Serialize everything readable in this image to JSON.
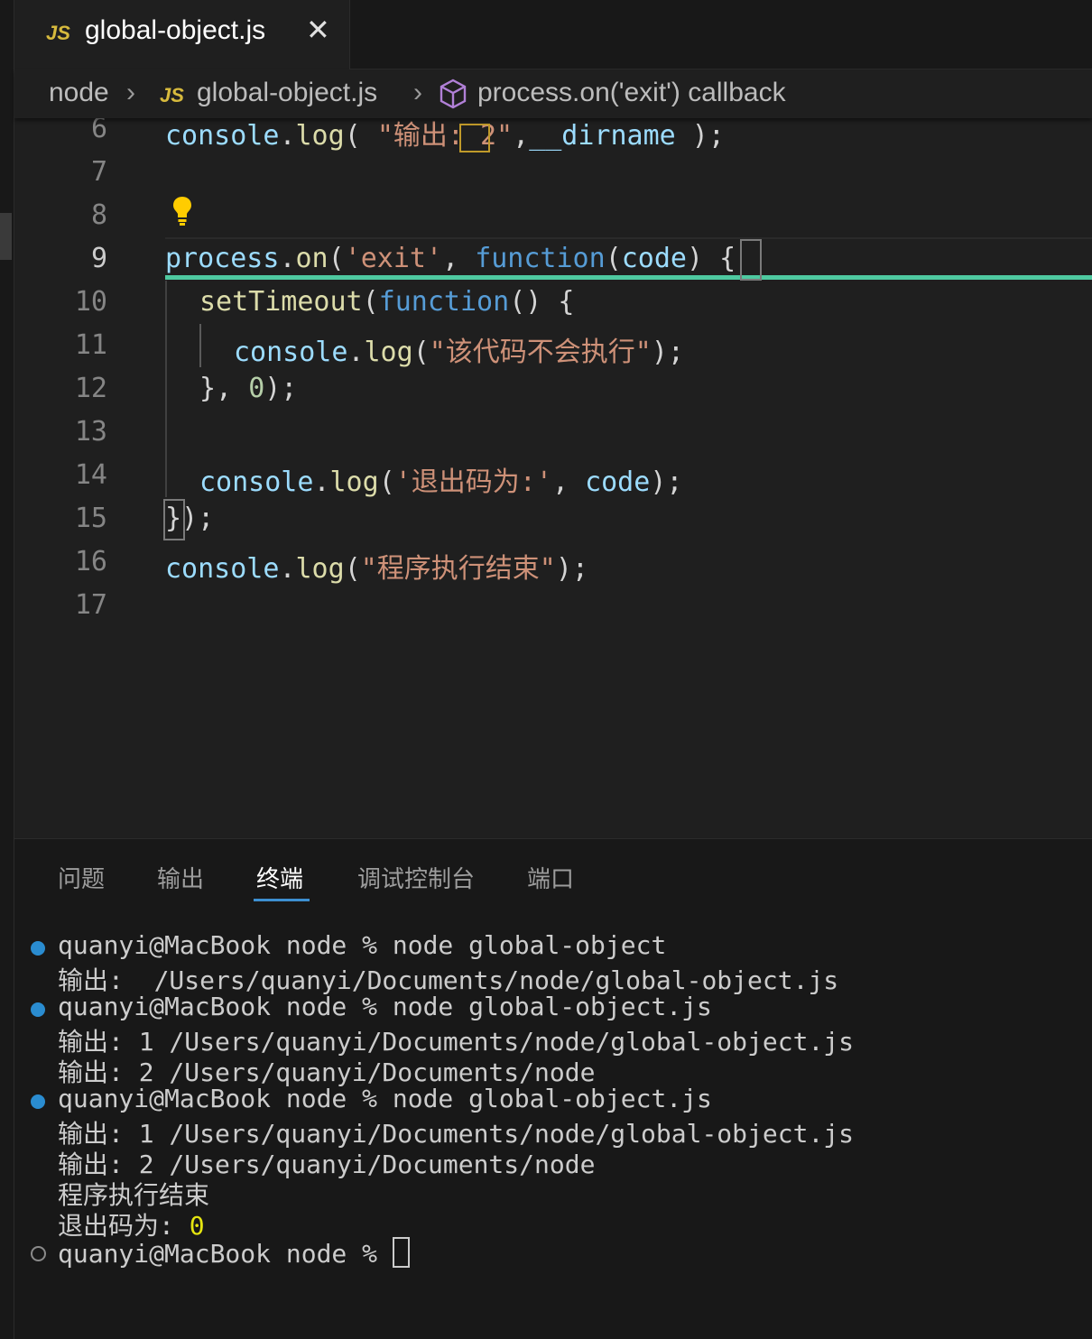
{
  "tab": {
    "icon": "JS",
    "filename": "global-object.js",
    "close_glyph": "✕"
  },
  "breadcrumb": {
    "folder": "node",
    "sep": "›",
    "file_icon": "JS",
    "file": "global-object.js",
    "symbol_icon": "cube-icon",
    "symbol": "process.on('exit') callback"
  },
  "editor": {
    "line_numbers": [
      "6",
      "7",
      "8",
      "9",
      "10",
      "11",
      "12",
      "13",
      "14",
      "15",
      "16",
      "17"
    ],
    "active_line": "9",
    "lines": {
      "l6": {
        "a": "console",
        "b": ".",
        "c": "log",
        "d": "( ",
        "e": "\"输出: 2\"",
        "f": ",",
        "g": "__dirname",
        "h": " );"
      },
      "l9": {
        "a": "process",
        "b": ".",
        "c": "on",
        "d": "(",
        "e": "'exit'",
        "f": ", ",
        "g": "function",
        "h": "(",
        "i": "code",
        "j": ") ",
        "k": "{"
      },
      "l10": {
        "a": "setTimeout",
        "b": "(",
        "c": "function",
        "d": "() {"
      },
      "l11": {
        "a": "console",
        "b": ".",
        "c": "log",
        "d": "(",
        "e": "\"该代码不会执行\"",
        "f": ");"
      },
      "l12": {
        "a": "}, ",
        "b": "0",
        "c": ");"
      },
      "l14": {
        "a": "console",
        "b": ".",
        "c": "log",
        "d": "(",
        "e": "'退出码为:'",
        "f": ", ",
        "g": "code",
        "h": ");"
      },
      "l15": {
        "a": "}",
        "b": ");"
      },
      "l16": {
        "a": "console",
        "b": ".",
        "c": "log",
        "d": "(",
        "e": "\"程序执行结束\"",
        "f": ");"
      }
    }
  },
  "panel": {
    "tabs": [
      "问题",
      "输出",
      "终端",
      "调试控制台",
      "端口"
    ],
    "active_tab": "终端"
  },
  "terminal": {
    "lines": [
      "quanyi@MacBook node % node global-object",
      "输出:  /Users/quanyi/Documents/node/global-object.js",
      "quanyi@MacBook node % node global-object.js",
      "输出: 1 /Users/quanyi/Documents/node/global-object.js",
      "输出: 2 /Users/quanyi/Documents/node",
      "quanyi@MacBook node % node global-object.js",
      "输出: 1 /Users/quanyi/Documents/node/global-object.js",
      "输出: 2 /Users/quanyi/Documents/node",
      "程序执行结束",
      "退出码为: ",
      "quanyi@MacBook node % "
    ],
    "exit_code": "0"
  },
  "colors": {
    "accent": "#3d8fd1",
    "current_line_marker": "#4ec9a0",
    "js_icon": "#d7ba3d"
  }
}
